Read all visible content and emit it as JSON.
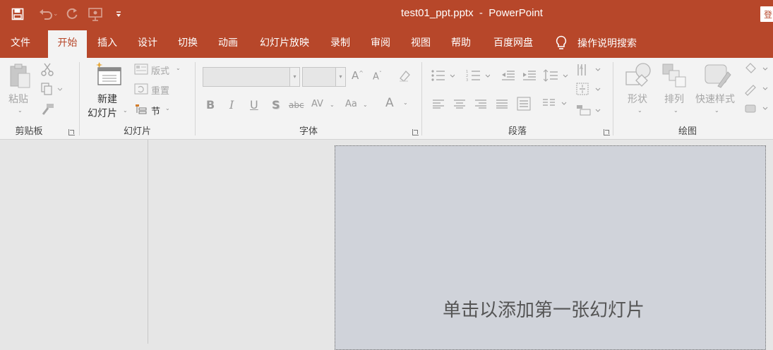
{
  "window": {
    "title": "test01_ppt.pptx  -  PowerPoint",
    "signin_label": "登"
  },
  "quick_access": {
    "items": [
      "save-icon",
      "undo-icon",
      "redo-icon",
      "present-from-start-icon",
      "customize-qat-icon"
    ]
  },
  "tabs": [
    "文件",
    "开始",
    "插入",
    "设计",
    "切换",
    "动画",
    "幻灯片放映",
    "录制",
    "审阅",
    "视图",
    "帮助",
    "百度网盘"
  ],
  "active_tab": "开始",
  "tell_me": {
    "label": "操作说明搜索",
    "icon": "lightbulb-icon"
  },
  "ribbon": {
    "clipboard": {
      "label": "剪贴板",
      "paste": "粘贴"
    },
    "slides": {
      "label": "幻灯片",
      "new_slide_line1": "新建",
      "new_slide_line2": "幻灯片",
      "layout": "版式",
      "reset": "重置",
      "section": "节"
    },
    "font": {
      "label": "字体",
      "font_name": "",
      "font_size": "",
      "bold": "B",
      "italic": "I",
      "underline": "U",
      "shadow": "S",
      "strikethrough": "abc",
      "spacing": "AV",
      "change_case": "Aa",
      "font_color": "A"
    },
    "paragraph": {
      "label": "段落"
    },
    "drawing": {
      "label": "绘图",
      "shapes": "形状",
      "arrange": "排列",
      "quick_styles": "快速样式"
    }
  },
  "slide": {
    "placeholder": "单击以添加第一张幻灯片"
  },
  "colors": {
    "accent": "#b7472a",
    "ribbon_bg": "#f3f3f3",
    "workspace_bg": "#e6e6e6",
    "slide_bg": "#d0d3da",
    "disabled": "#a6a6a6"
  }
}
